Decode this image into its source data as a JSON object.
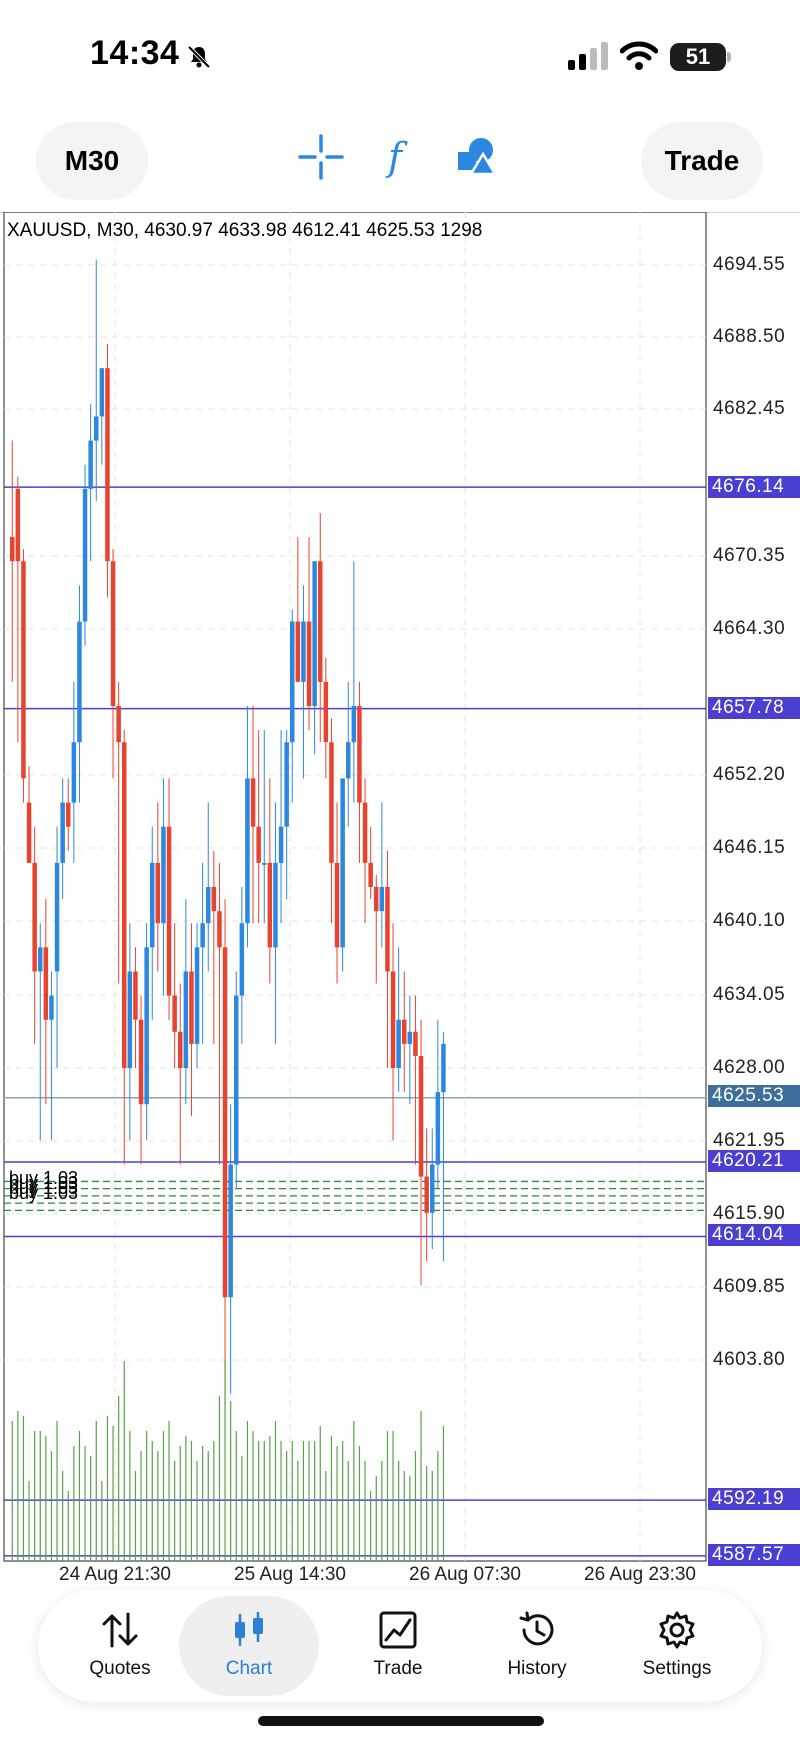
{
  "status": {
    "time": "14:34",
    "battery": "51"
  },
  "toolbar": {
    "timeframe": "M30",
    "trade_label": "Trade",
    "icons": [
      "crosshair-icon",
      "function-icon",
      "shapes-icon"
    ]
  },
  "chart": {
    "info": "XAUUSD, M30, 4630.97 4633.98 4612.41 4625.53 1298",
    "price_scale": [
      "4694.55",
      "4688.50",
      "4682.45",
      "4670.35",
      "4664.30",
      "4652.20",
      "4646.15",
      "4640.10",
      "4634.05",
      "4628.00",
      "4621.95",
      "4615.90",
      "4609.85",
      "4603.80"
    ],
    "level_tags": [
      {
        "value": "4676.14",
        "color": "#4a3fd1"
      },
      {
        "value": "4657.78",
        "color": "#4a3fd1"
      },
      {
        "value": "4625.53",
        "color": "#3d6e9c"
      },
      {
        "value": "4620.21",
        "color": "#4a3fd1"
      },
      {
        "value": "4614.04",
        "color": "#4a3fd1"
      },
      {
        "value": "4592.19",
        "color": "#4a3fd1"
      },
      {
        "value": "4587.57",
        "color": "#4a3fd1"
      }
    ],
    "time_labels": [
      "24 Aug 21:30",
      "25 Aug 14:30",
      "26 Aug 07:30",
      "26 Aug 23:30"
    ],
    "order_labels": [
      "buy 1.03",
      "buy 1.03",
      "buy 1.03",
      "buy 1.03"
    ],
    "colors": {
      "bull": "#2b87e0",
      "bear": "#e8432e",
      "volume": "#5aa04a",
      "order_line": "#2e8b3a",
      "level_line": "#4a3fd1"
    }
  },
  "chart_data": {
    "type": "candlestick",
    "symbol": "XAUUSD",
    "timeframe": "M30",
    "ylim": [
      4585,
      4697
    ],
    "candles": [
      [
        4672,
        4680,
        4660,
        4670
      ],
      [
        4676,
        4677,
        4655,
        4670
      ],
      [
        4670,
        4671,
        4650,
        4652
      ],
      [
        4650,
        4653,
        4645,
        4645
      ],
      [
        4645,
        4648,
        4630,
        4636
      ],
      [
        4636,
        4640,
        4622,
        4638
      ],
      [
        4638,
        4642,
        4625,
        4632
      ],
      [
        4632,
        4636,
        4622,
        4634
      ],
      [
        4636,
        4648,
        4628,
        4645
      ],
      [
        4645,
        4652,
        4642,
        4650
      ],
      [
        4650,
        4652,
        4646,
        4648
      ],
      [
        4650,
        4660,
        4645,
        4655
      ],
      [
        4655,
        4668,
        4650,
        4665
      ],
      [
        4665,
        4678,
        4663,
        4676
      ],
      [
        4676,
        4683,
        4670,
        4680
      ],
      [
        4680,
        4695,
        4675,
        4682
      ],
      [
        4682,
        4686,
        4678,
        4686
      ],
      [
        4686,
        4688,
        4667,
        4670
      ],
      [
        4670,
        4671,
        4652,
        4658
      ],
      [
        4658,
        4660,
        4635,
        4655
      ],
      [
        4655,
        4656,
        4620,
        4628
      ],
      [
        4628,
        4640,
        4622,
        4636
      ],
      [
        4636,
        4638,
        4628,
        4632
      ],
      [
        4632,
        4634,
        4620,
        4625
      ],
      [
        4625,
        4640,
        4622,
        4638
      ],
      [
        4638,
        4648,
        4632,
        4645
      ],
      [
        4645,
        4650,
        4636,
        4640
      ],
      [
        4640,
        4652,
        4634,
        4648
      ],
      [
        4648,
        4652,
        4632,
        4634
      ],
      [
        4634,
        4640,
        4628,
        4631
      ],
      [
        4631,
        4635,
        4620,
        4628
      ],
      [
        4628,
        4642,
        4625,
        4636
      ],
      [
        4636,
        4640,
        4624,
        4630
      ],
      [
        4630,
        4640,
        4628,
        4638
      ],
      [
        4638,
        4645,
        4630,
        4640
      ],
      [
        4640,
        4650,
        4636,
        4643
      ],
      [
        4643,
        4646,
        4630,
        4641
      ],
      [
        4641,
        4645,
        4620,
        4638
      ],
      [
        4638,
        4642,
        4600,
        4609
      ],
      [
        4609,
        4625,
        4601,
        4620
      ],
      [
        4620,
        4636,
        4618,
        4634
      ],
      [
        4634,
        4643,
        4630,
        4640
      ],
      [
        4640,
        4658,
        4638,
        4652
      ],
      [
        4652,
        4658,
        4640,
        4648
      ],
      [
        4648,
        4656,
        4640,
        4645
      ],
      [
        4645,
        4656,
        4640,
        4645
      ],
      [
        4645,
        4652,
        4635,
        4638
      ],
      [
        4638,
        4650,
        4630,
        4645
      ],
      [
        4645,
        4656,
        4640,
        4648
      ],
      [
        4648,
        4656,
        4642,
        4655
      ],
      [
        4655,
        4666,
        4650,
        4665
      ],
      [
        4665,
        4672,
        4660,
        4660
      ],
      [
        4660,
        4668,
        4652,
        4665
      ],
      [
        4665,
        4672,
        4656,
        4658
      ],
      [
        4658,
        4670,
        4654,
        4670
      ],
      [
        4670,
        4674,
        4655,
        4660
      ],
      [
        4660,
        4662,
        4652,
        4655
      ],
      [
        4655,
        4657,
        4640,
        4645
      ],
      [
        4645,
        4650,
        4635,
        4638
      ],
      [
        4638,
        4652,
        4636,
        4652
      ],
      [
        4652,
        4660,
        4648,
        4655
      ],
      [
        4655,
        4670,
        4650,
        4658
      ],
      [
        4658,
        4660,
        4645,
        4650
      ],
      [
        4650,
        4652,
        4640,
        4645
      ],
      [
        4645,
        4648,
        4642,
        4643
      ],
      [
        4643,
        4644,
        4635,
        4641
      ],
      [
        4641,
        4650,
        4638,
        4643
      ],
      [
        4643,
        4646,
        4628,
        4636
      ],
      [
        4636,
        4640,
        4622,
        4628
      ],
      [
        4628,
        4638,
        4626,
        4632
      ],
      [
        4632,
        4636,
        4626,
        4630
      ],
      [
        4630,
        4634,
        4625,
        4631
      ],
      [
        4631,
        4634,
        4620,
        4629
      ],
      [
        4629,
        4632,
        4610,
        4619
      ],
      [
        4619,
        4623,
        4612,
        4616
      ],
      [
        4616,
        4623,
        4613,
        4620
      ],
      [
        4620,
        4632,
        4618,
        4626
      ],
      [
        4626,
        4631,
        4612,
        4630
      ]
    ]
  },
  "tabs": [
    {
      "label": "Quotes",
      "icon": "quotes-icon"
    },
    {
      "label": "Chart",
      "icon": "chart-icon"
    },
    {
      "label": "Trade",
      "icon": "trade-icon"
    },
    {
      "label": "History",
      "icon": "history-icon"
    },
    {
      "label": "Settings",
      "icon": "settings-icon"
    }
  ]
}
